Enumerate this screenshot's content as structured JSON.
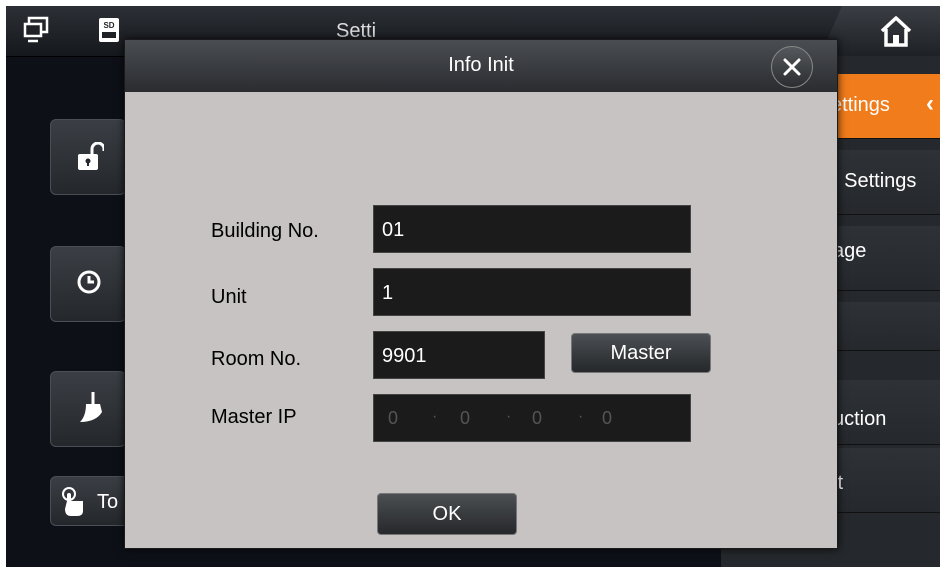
{
  "topbar": {
    "title": "Setti",
    "sd_label": "SD"
  },
  "left_panel": {
    "tail_label": "To"
  },
  "right_panel": {
    "items": [
      {
        "label": "ettings",
        "active": true
      },
      {
        "label": ": Settings",
        "active": false
      },
      {
        "label": "age",
        "active": false
      },
      {
        "label": "",
        "active": false
      },
      {
        "label": "uction",
        "active": false
      },
      {
        "label": "it",
        "active": false
      }
    ],
    "active_color": "#f07c1b"
  },
  "dialog": {
    "title": "Info Init",
    "fields": {
      "building_label": "Building No.",
      "building_value": "01",
      "unit_label": "Unit",
      "unit_value": "1",
      "room_label": "Room No.",
      "room_value": "9901",
      "master_button": "Master",
      "master_ip_label": "Master IP",
      "master_ip": [
        "0",
        "0",
        "0",
        "0"
      ]
    },
    "ok_button": "OK"
  },
  "icons": [
    "monitor-icon",
    "sd-card-icon",
    "home-icon",
    "close-icon",
    "unlock-icon",
    "clock-icon",
    "broom-icon",
    "touch-hand-icon"
  ]
}
